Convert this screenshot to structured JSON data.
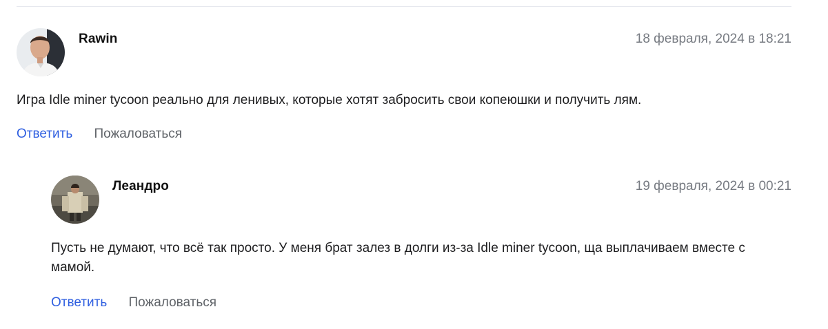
{
  "comments": [
    {
      "author": "Rawin",
      "date": "18 февраля, 2024 в 18:21",
      "text": "Игра Idle miner tycoon реально для ленивых, которые хотят забросить свои копеюшки и получить лям.",
      "reply_label": "Ответить",
      "report_label": "Пожаловаться"
    },
    {
      "author": "Леандро",
      "date": "19 февраля, 2024 в 00:21",
      "text": "Пусть не думают, что всё так просто. У меня брат залез в долги из-за Idle miner tycoon, ща выплачиваем вместе с мамой.",
      "reply_label": "Ответить",
      "report_label": "Пожаловаться"
    }
  ],
  "colors": {
    "link": "#2f5fe0",
    "muted": "#777b82",
    "divider": "#e6e8ee"
  }
}
